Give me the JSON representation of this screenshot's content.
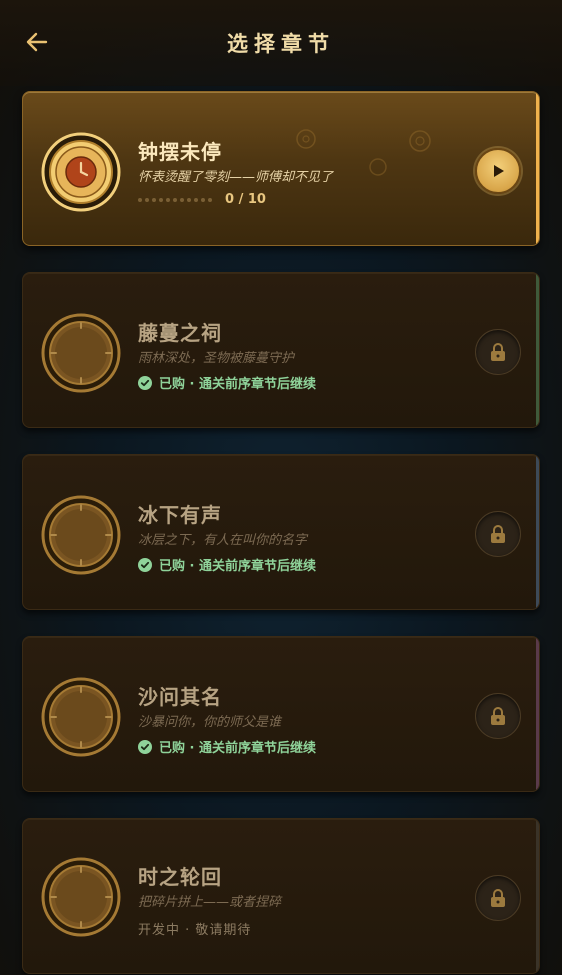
{
  "header": {
    "title": "选择章节",
    "back_icon": "arrow-left-icon"
  },
  "colors": {
    "accent_gold": "#f2c96f",
    "status_green": "#8fd39a",
    "card_bg": "#22180b"
  },
  "chapters": [
    {
      "title": "钟摆未停",
      "subtitle": "怀表烫醒了零刻——师傅却不见了",
      "progress_text": "0 / 10",
      "progress": 0,
      "state": "active",
      "action_icon": "play-icon"
    },
    {
      "title": "藤蔓之祠",
      "subtitle": "雨林深处，圣物被藤蔓守护",
      "status": "已购 · 通关前序章节后继续",
      "state": "locked",
      "action_icon": "lock-icon"
    },
    {
      "title": "冰下有声",
      "subtitle": "冰层之下，有人在叫你的名字",
      "status": "已购 · 通关前序章节后继续",
      "state": "locked",
      "action_icon": "lock-icon"
    },
    {
      "title": "沙问其名",
      "subtitle": "沙暴问你，你的师父是谁",
      "status": "已购 · 通关前序章节后继续",
      "state": "locked",
      "action_icon": "lock-icon"
    },
    {
      "title": "时之轮回",
      "subtitle": "把碎片拼上——或者捏碎",
      "status": "开发中 · 敬请期待",
      "state": "in-development",
      "action_icon": "lock-icon"
    }
  ]
}
